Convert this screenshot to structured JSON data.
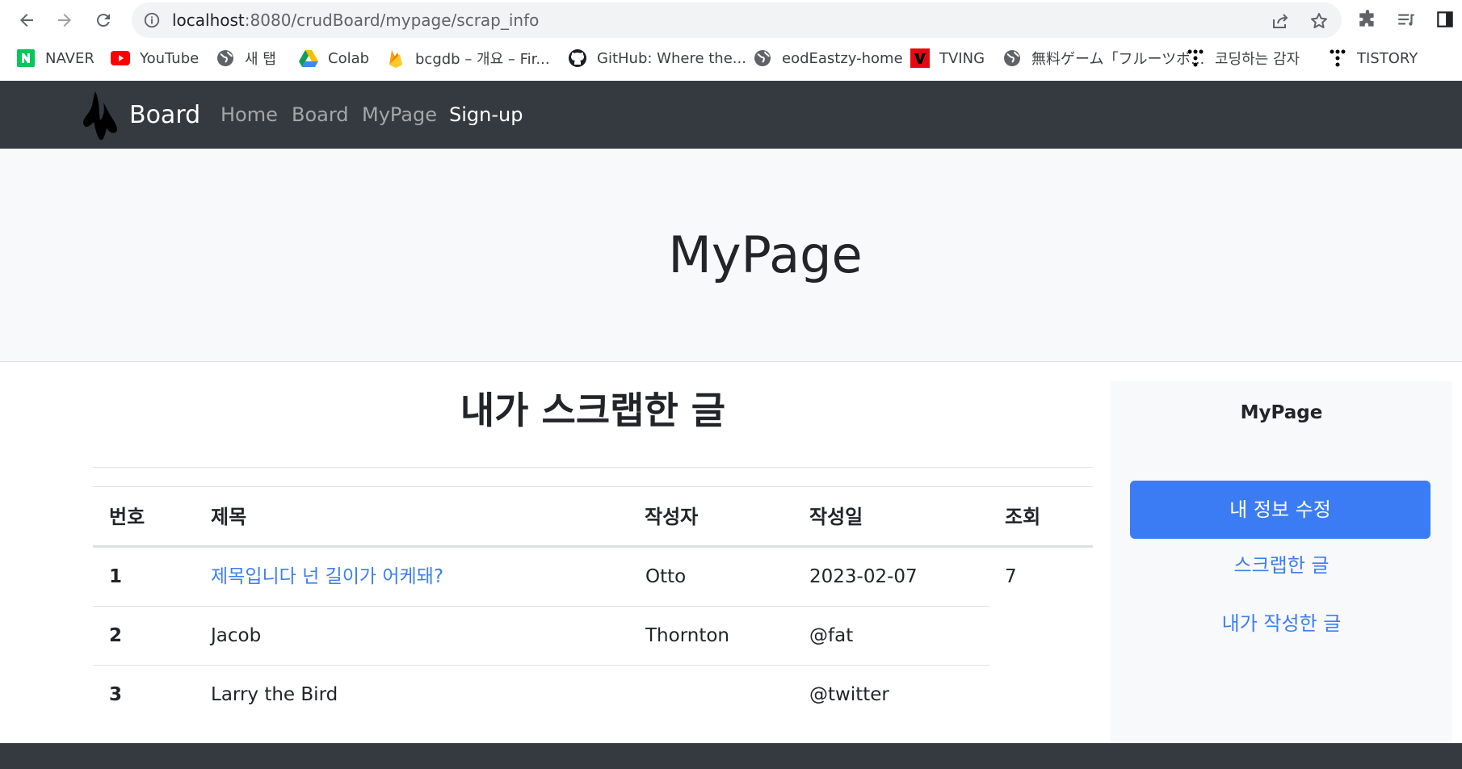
{
  "browser": {
    "url_host": "localhost",
    "url_path": ":8080/crudBoard/mypage/scrap_info",
    "bookmarks": [
      {
        "label": "NAVER",
        "icon": "naver-icon"
      },
      {
        "label": "YouTube",
        "icon": "youtube-icon"
      },
      {
        "label": "새 탭",
        "icon": "globe-icon"
      },
      {
        "label": "Colab",
        "icon": "google-drive-icon"
      },
      {
        "label": "bcgdb – 개요 – Fir...",
        "icon": "firebase-icon"
      },
      {
        "label": "GitHub: Where the...",
        "icon": "github-icon"
      },
      {
        "label": "eodEastzy-home",
        "icon": "globe-icon"
      },
      {
        "label": "TVING",
        "icon": "tving-icon"
      },
      {
        "label": "無料ゲーム「フルーツボ...",
        "icon": "globe-icon"
      },
      {
        "label": "코딩하는 감자",
        "icon": "tistory-icon"
      },
      {
        "label": "TISTORY",
        "icon": "tistory-icon"
      }
    ]
  },
  "navbar": {
    "brand": "Board",
    "links": [
      "Home",
      "Board",
      "MyPage",
      "Sign-up"
    ],
    "active_index": 3
  },
  "hero": {
    "title": "MyPage"
  },
  "main": {
    "title": "내가 스크랩한 글",
    "headers": [
      "번호",
      "제목",
      "작성자",
      "작성일",
      "조회"
    ],
    "rows": [
      {
        "num": "1",
        "title": "제목입니다 넌 길이가 어케돼?",
        "author": "Otto",
        "date": "2023-02-07",
        "views": "7"
      },
      {
        "num": "2",
        "title": "Jacob",
        "author": "Thornton",
        "date": "@fat",
        "views": ""
      },
      {
        "num": "3",
        "title": "Larry the Bird",
        "author": "",
        "date": "@twitter",
        "views": ""
      }
    ]
  },
  "sidebar": {
    "title": "MyPage",
    "button": "내 정보 수정",
    "links": [
      "스크랩한 글",
      "내가 작성한 글"
    ]
  },
  "colors": {
    "navbar": "#343a40",
    "primary": "#3b7cf5",
    "link": "#3d7ef0"
  }
}
